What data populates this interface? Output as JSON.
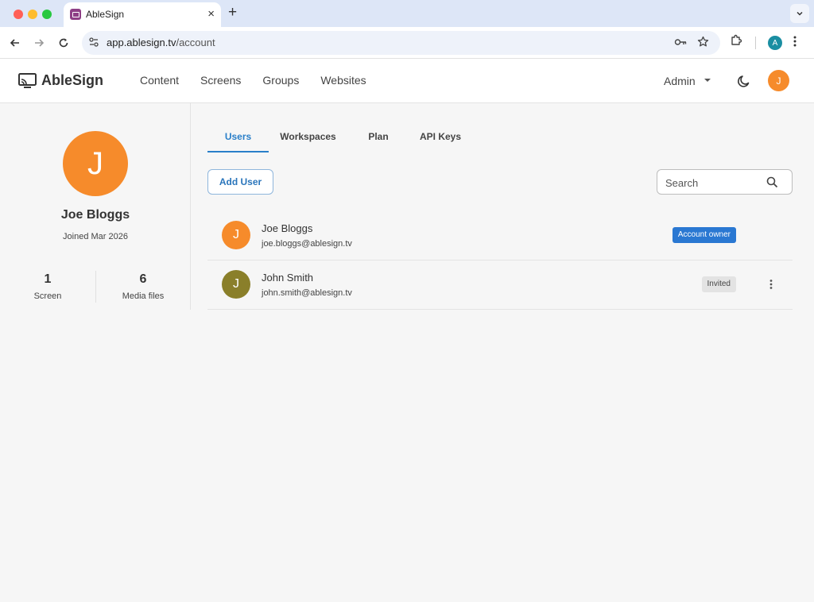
{
  "browser": {
    "tab_title": "AbleSign",
    "url_host": "app.ablesign.tv",
    "url_path": "/account",
    "profile_initial": "A"
  },
  "header": {
    "brand": "AbleSign",
    "nav": [
      "Content",
      "Screens",
      "Groups",
      "Websites"
    ],
    "role_label": "Admin",
    "avatar_initial": "J"
  },
  "profile": {
    "initial": "J",
    "name": "Joe Bloggs",
    "joined": "Joined Mar 2026",
    "stats": [
      {
        "value": "1",
        "label": "Screen"
      },
      {
        "value": "6",
        "label": "Media files"
      }
    ]
  },
  "tabs": [
    {
      "label": "Users",
      "active": true
    },
    {
      "label": "Workspaces",
      "active": false
    },
    {
      "label": "Plan",
      "active": false
    },
    {
      "label": "API Keys",
      "active": false
    }
  ],
  "actions": {
    "add_user_label": "Add User",
    "search_placeholder": "Search"
  },
  "users": [
    {
      "initial": "J",
      "name": "Joe Bloggs",
      "email": "joe.bloggs@ablesign.tv",
      "badge": "Account owner",
      "avatar_color": "#f68b2b"
    },
    {
      "initial": "J",
      "name": "John Smith",
      "email": "john.smith@ablesign.tv",
      "badge": "Invited",
      "avatar_color": "#8a7f2a"
    }
  ],
  "colors": {
    "accent": "#2a7fc9",
    "brand_orange": "#f68b2b"
  }
}
